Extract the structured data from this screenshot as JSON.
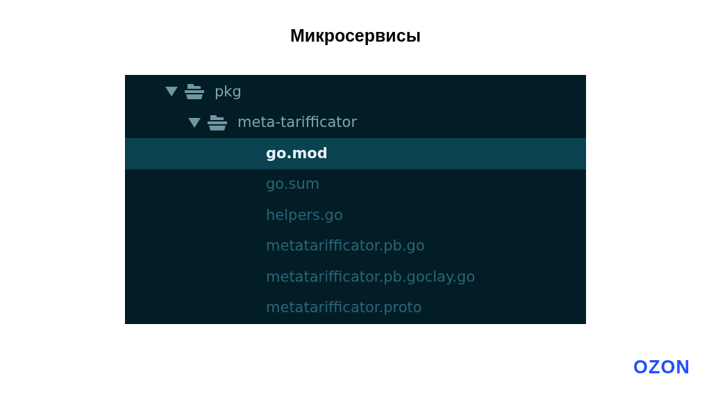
{
  "slide": {
    "title": "Микросервисы",
    "logo": "OZON"
  },
  "tree": [
    {
      "label": "pkg",
      "kind": "folder",
      "expanded": true,
      "selected": false,
      "children": [
        {
          "label": "meta-tarifficator",
          "kind": "folder",
          "expanded": true,
          "selected": false,
          "children": [
            {
              "label": "go.mod",
              "kind": "file",
              "selected": true
            },
            {
              "label": "go.sum",
              "kind": "file",
              "selected": false
            },
            {
              "label": "helpers.go",
              "kind": "file",
              "selected": false
            },
            {
              "label": "metatarifficator.pb.go",
              "kind": "file",
              "selected": false
            },
            {
              "label": "metatarifficator.pb.goclay.go",
              "kind": "file",
              "selected": false
            },
            {
              "label": "metatarifficator.proto",
              "kind": "file",
              "selected": false
            }
          ]
        }
      ]
    }
  ]
}
